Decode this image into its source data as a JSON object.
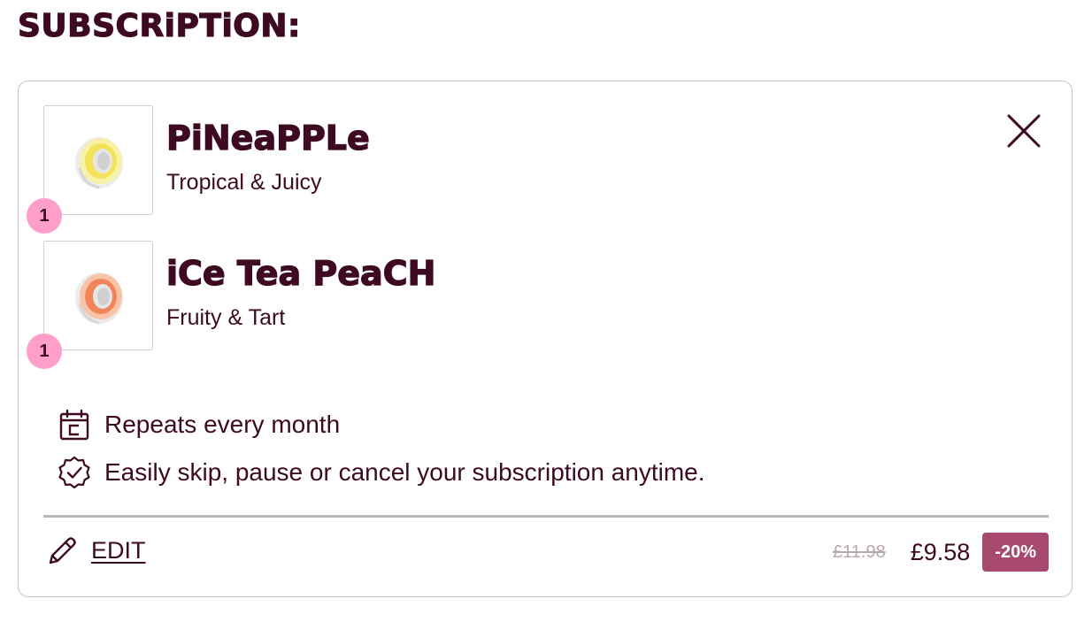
{
  "heading": "SUBSCRiPTiON:",
  "items": [
    {
      "name": "PiNeaPPLe",
      "description": "Tropical & Juicy",
      "quantity": "1",
      "image_icon": "pineapple-pod-image",
      "accent_color": "#f4e25a"
    },
    {
      "name": "iCe Tea PeaCH",
      "description": "Fruity & Tart",
      "quantity": "1",
      "image_icon": "ice-tea-peach-pod-image",
      "accent_color": "#f2845a"
    }
  ],
  "close_icon": "close-icon",
  "info": [
    {
      "icon": "calendar-icon",
      "text": "Repeats every month"
    },
    {
      "icon": "verified-badge-icon",
      "text": "Easily skip, pause or cancel your subscription anytime."
    }
  ],
  "footer": {
    "edit_icon": "pencil-icon",
    "edit_label": "EDIT",
    "old_price": "£11.98",
    "new_price": "£9.58",
    "discount": "-20%"
  },
  "colors": {
    "text": "#3d0a22",
    "badge_pink": "#ff9ec9",
    "discount_bg": "#a8496e",
    "strike_price": "#b7a9b0",
    "border": "#c9c2c5"
  }
}
